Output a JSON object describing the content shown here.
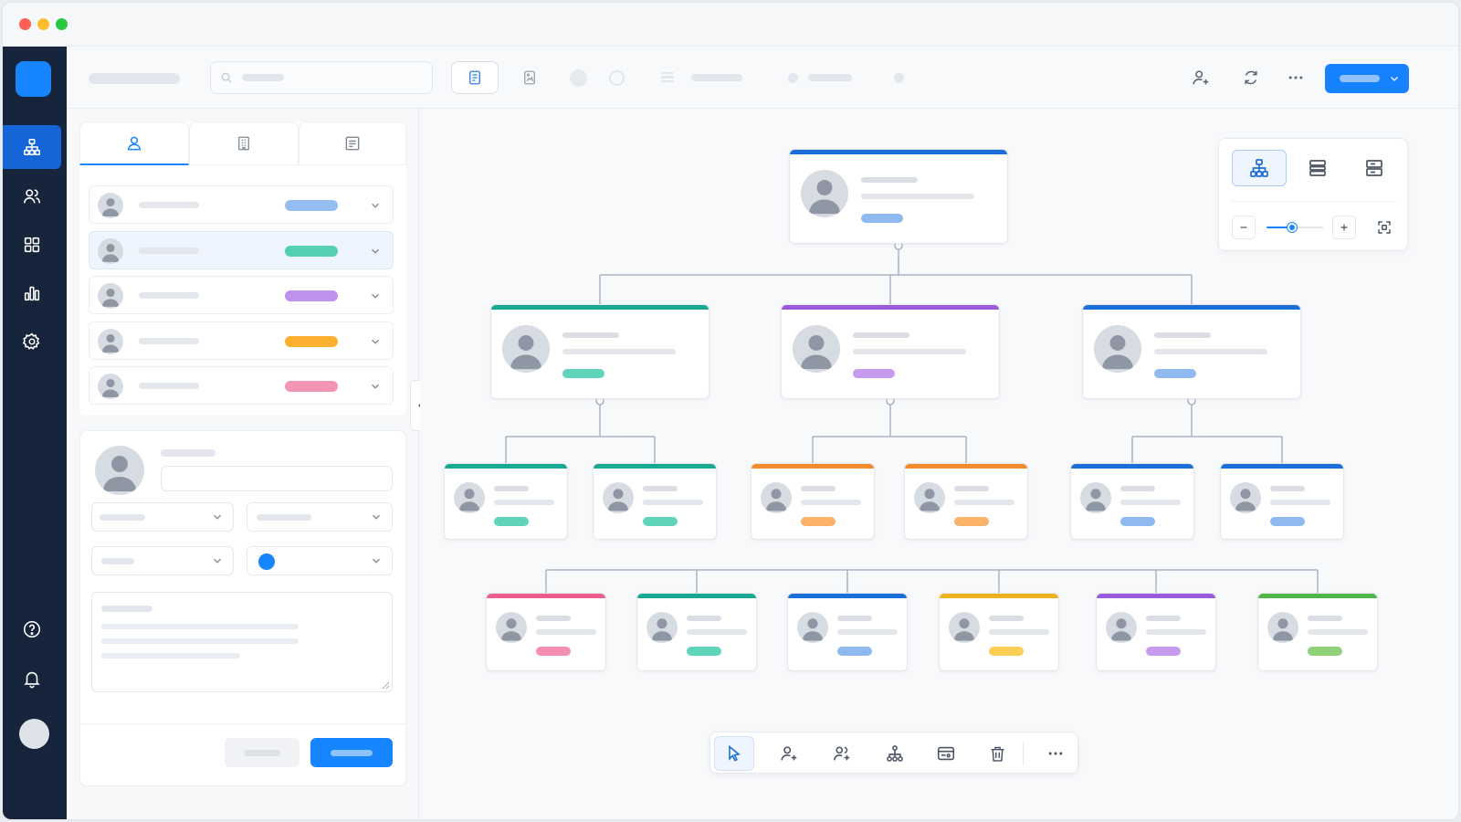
{
  "window": {
    "controls": [
      {
        "name": "close",
        "color": "#ff5f57"
      },
      {
        "name": "minimize",
        "color": "#febc2e"
      },
      {
        "name": "zoom",
        "color": "#28c840"
      }
    ]
  },
  "colors": {
    "sidebar_bg": "#16253b",
    "accent": "#1785ff",
    "teal": "#4fd1b5",
    "purple": "#b98bea",
    "blue": "#8fb9ef",
    "orange": "#fbb24a",
    "pink": "#f58fb0",
    "green": "#8fd27a"
  },
  "sidebar": {
    "items": [
      {
        "icon": "org-chart-icon",
        "active": true
      },
      {
        "icon": "users-icon",
        "active": false
      },
      {
        "icon": "grid-icon",
        "active": false
      },
      {
        "icon": "bar-chart-icon",
        "active": false
      },
      {
        "icon": "gear-icon",
        "active": false
      }
    ],
    "bottom": [
      "help-icon",
      "bell-icon",
      "avatar"
    ]
  },
  "toolbar": {
    "right_icons": [
      "add-user-icon",
      "refresh-icon",
      "more-icon"
    ],
    "primary_dropdown_icon": "chevron-down-icon"
  },
  "left_panel": {
    "tabs": [
      {
        "icon": "person-icon",
        "active": true
      },
      {
        "icon": "building-icon",
        "active": false
      },
      {
        "icon": "document-icon",
        "active": false
      }
    ],
    "people": [
      {
        "status_color": "#94bdf1",
        "selected": false
      },
      {
        "status_color": "#53cfb2",
        "selected": true
      },
      {
        "status_color": "#bc92ec",
        "selected": false
      },
      {
        "status_color": "#fbb12f",
        "selected": false
      },
      {
        "status_color": "#f595b5",
        "selected": false
      }
    ],
    "form": {
      "color_swatch": "#1785ff"
    }
  },
  "view_panel": {
    "modes": [
      "tree-view-icon",
      "list-view-icon",
      "compact-view-icon"
    ],
    "zoom_fraction": 0.45
  },
  "bottom_toolbar": {
    "tools": [
      "pointer-icon",
      "add-person-icon",
      "add-group-icon",
      "hierarchy-icon",
      "card-icon",
      "trash-icon",
      "more-icon"
    ]
  },
  "org_chart": {
    "root": {
      "bar": "#1a6fd9",
      "badge": "#8fb9ef"
    },
    "level1": [
      {
        "bar": "#17a991",
        "badge": "#5fd4bb"
      },
      {
        "bar": "#9a5ad9",
        "badge": "#c69bee"
      },
      {
        "bar": "#1a6fd9",
        "badge": "#8fb9ef"
      }
    ],
    "level2": [
      {
        "bar": "#17a991",
        "badge": "#5fd4bb"
      },
      {
        "bar": "#17a991",
        "badge": "#5fd4bb"
      },
      {
        "bar": "#f28a2e",
        "badge": "#fbb26a"
      },
      {
        "bar": "#f28a2e",
        "badge": "#fbb26a"
      },
      {
        "bar": "#1a6fd9",
        "badge": "#8fb9ef"
      },
      {
        "bar": "#1a6fd9",
        "badge": "#8fb9ef"
      }
    ],
    "level3": [
      {
        "bar": "#ec5f8b",
        "badge": "#f58fb0"
      },
      {
        "bar": "#17a991",
        "badge": "#5fd4bb"
      },
      {
        "bar": "#1a6fd9",
        "badge": "#8fb9ef"
      },
      {
        "bar": "#f2b21d",
        "badge": "#fbcf55"
      },
      {
        "bar": "#9a5ad9",
        "badge": "#c69bee"
      },
      {
        "bar": "#4fb648",
        "badge": "#8fd27a"
      }
    ]
  }
}
